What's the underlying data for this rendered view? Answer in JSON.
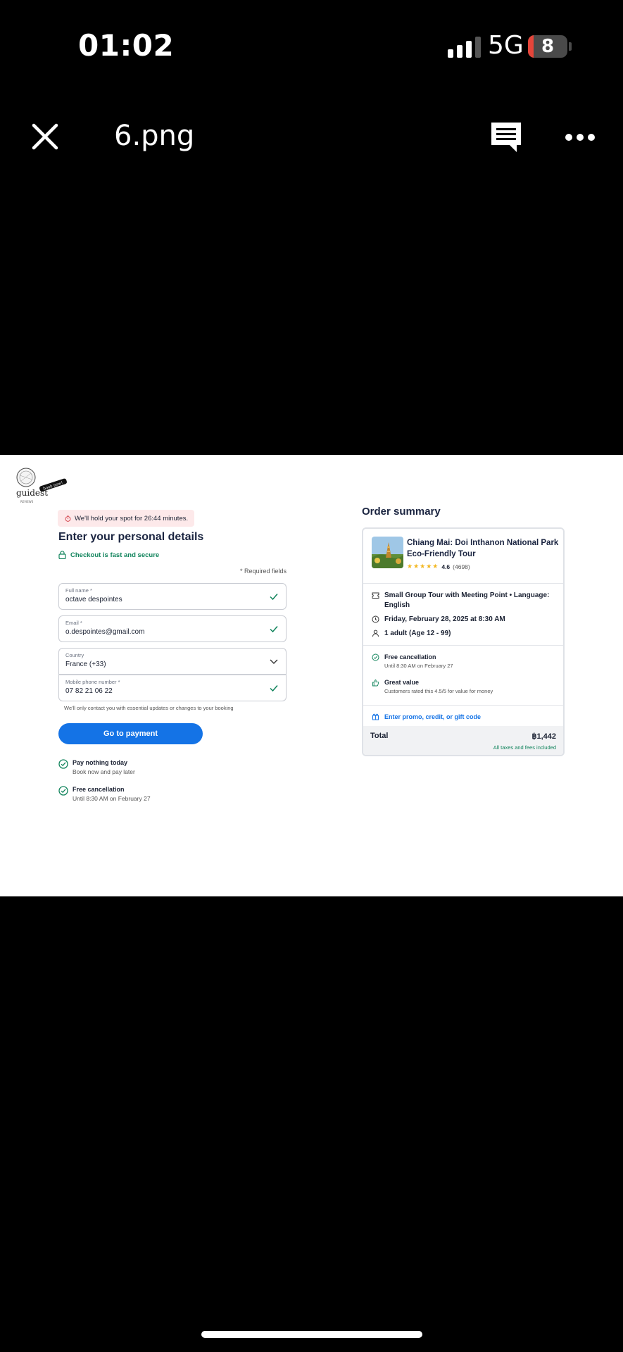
{
  "status_bar": {
    "time": "01:02",
    "network": "5G",
    "battery": "8",
    "battery_color": "#e5453a"
  },
  "viewer": {
    "title": "6.png",
    "close_icon": "close-icon",
    "comment_icon": "comment-icon",
    "more_icon": "more-icon"
  },
  "page": {
    "logo": {
      "name": "guidest",
      "badge": "book now!",
      "sub": "REVIEWS"
    },
    "hold_notice": "We'll hold your spot for 26:44 minutes.",
    "heading": "Enter your personal details",
    "secure_text": "Checkout is fast and secure",
    "required_note": "* Required fields",
    "fields": {
      "full_name": {
        "label": "Full name *",
        "value": "octave despointes"
      },
      "email": {
        "label": "Email *",
        "value": "o.despointes@gmail.com"
      },
      "country": {
        "label": "Country",
        "value": "France (+33)"
      },
      "phone": {
        "label": "Mobile phone number *",
        "value": "07 82 21 06 22"
      }
    },
    "contact_note": "We'll only contact you with essential updates or changes to your booking",
    "pay_button": "Go to payment",
    "perks": [
      {
        "title": "Pay nothing today",
        "sub": "Book now and pay later"
      },
      {
        "title": "Free cancellation",
        "sub": "Until 8:30 AM on February 27"
      }
    ],
    "summary": {
      "title": "Order summary",
      "tour_title": "Chiang Mai: Doi Inthanon National Park Eco-Friendly Tour",
      "rating": "4.6",
      "reviews": "(4698)",
      "details": [
        "Small Group Tour with Meeting Point • Language: English",
        "Friday, February 28, 2025 at 8:30 AM",
        "1 adult (Age 12 - 99)"
      ],
      "benefits": [
        {
          "title": "Free cancellation",
          "sub": "Until 8:30 AM on February 27"
        },
        {
          "title": "Great value",
          "sub": "Customers rated this 4.5/5 for value for money"
        }
      ],
      "promo": "Enter promo, credit, or gift code",
      "total_label": "Total",
      "total_value": "฿1,442",
      "total_note": "All taxes and fees included"
    },
    "colors": {
      "accent": "#1473e6",
      "success": "#11845c",
      "hold_bg": "#fde9ea"
    }
  }
}
